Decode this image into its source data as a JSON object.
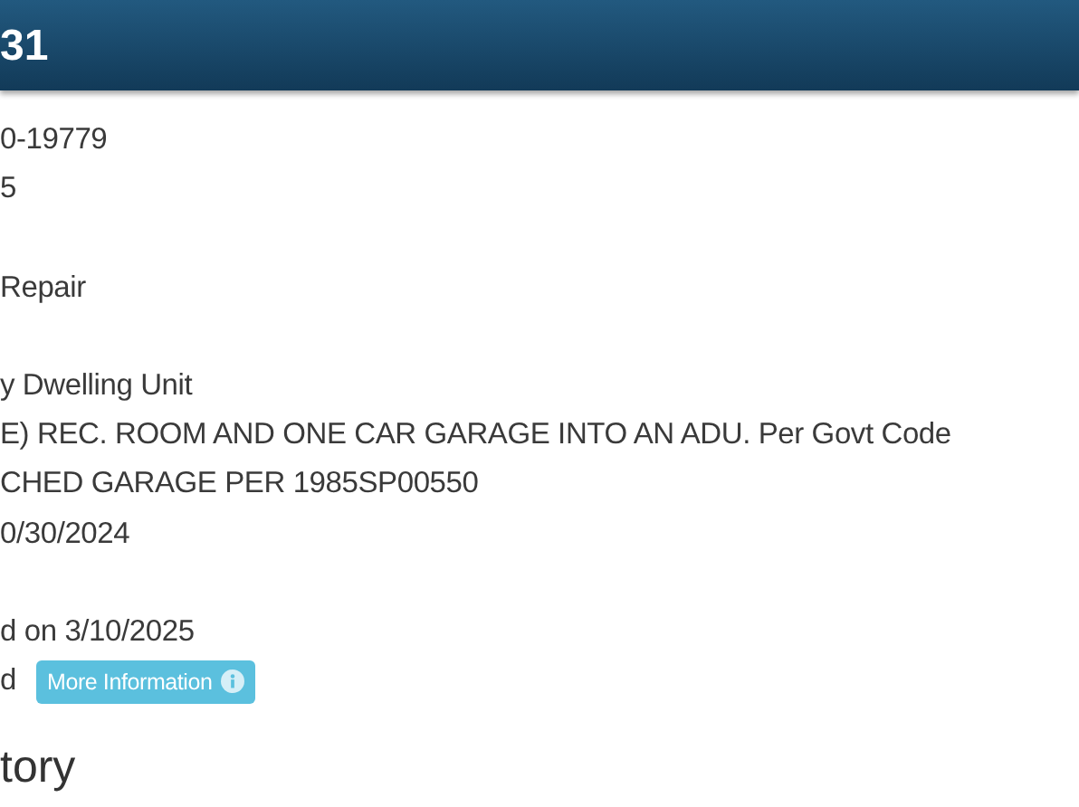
{
  "header": {
    "title": "31"
  },
  "groups": [
    {
      "lines": [
        {
          "text": "0-19779"
        },
        {
          "text": "5"
        }
      ]
    },
    {
      "lines": [
        {
          "text": "Repair"
        }
      ]
    },
    {
      "lines": [
        {
          "text": "y Dwelling Unit"
        },
        {
          "text": "E) REC. ROOM AND ONE CAR GARAGE INTO AN ADU. Per Govt Code"
        },
        {
          "text": "CHED GARAGE PER 1985SP00550"
        },
        {
          "text": "0/30/2024"
        }
      ]
    },
    {
      "lines": [
        {
          "text": "d on 3/10/2025"
        },
        {
          "text": "d",
          "button": "More Information"
        }
      ]
    }
  ],
  "section_heading": "tory"
}
